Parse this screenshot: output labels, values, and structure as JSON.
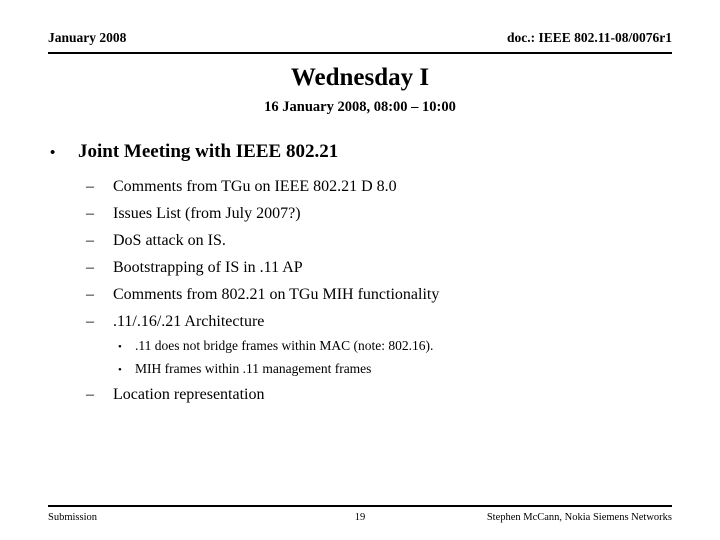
{
  "header": {
    "left": "January 2008",
    "right": "doc.: IEEE 802.11-08/0076r1"
  },
  "title": "Wednesday I",
  "subtitle": "16 January 2008, 08:00 – 10:00",
  "markers": {
    "level1": "•",
    "level2": "–",
    "level3": "•"
  },
  "outline": [
    {
      "level": 1,
      "text": "Joint Meeting with IEEE 802.21"
    },
    {
      "level": 2,
      "text": "Comments from TGu on IEEE 802.21 D 8.0"
    },
    {
      "level": 2,
      "text": "Issues List (from July 2007?)"
    },
    {
      "level": 2,
      "text": "DoS attack on IS."
    },
    {
      "level": 2,
      "text": "Bootstrapping of IS in .11 AP"
    },
    {
      "level": 2,
      "text": "Comments from 802.21 on TGu MIH functionality"
    },
    {
      "level": 2,
      "text": ".11/.16/.21 Architecture"
    },
    {
      "level": 3,
      "text": ".11 does not bridge frames within MAC (note: 802.16)."
    },
    {
      "level": 3,
      "text": "MIH frames within .11 management frames"
    },
    {
      "level": 2,
      "text": "Location representation"
    }
  ],
  "footer": {
    "left": "Submission",
    "page": "19",
    "right": "Stephen McCann, Nokia Siemens Networks"
  }
}
